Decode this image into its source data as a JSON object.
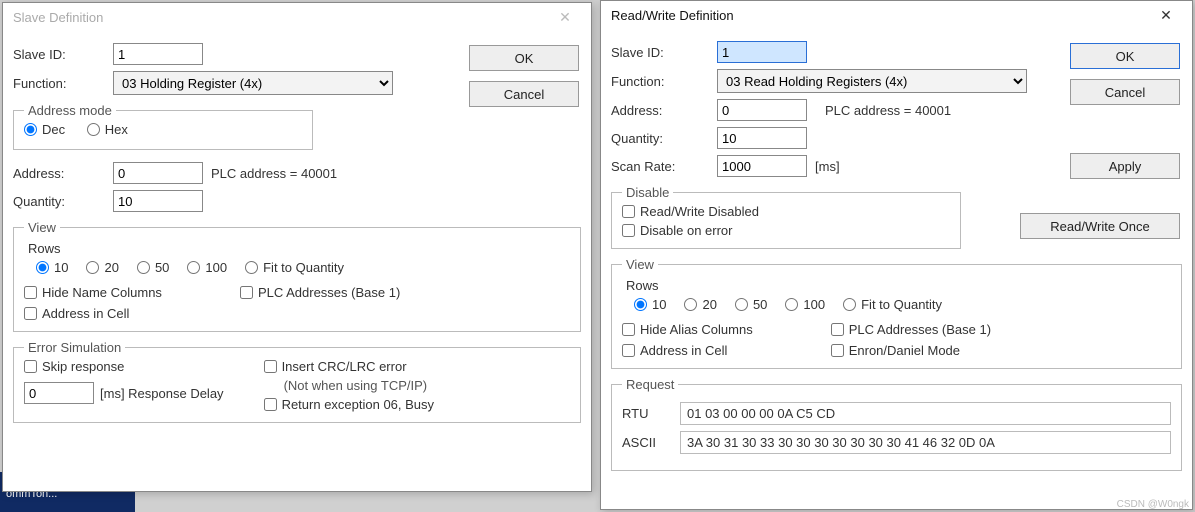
{
  "left": {
    "title": "Slave Definition",
    "ok": "OK",
    "cancel": "Cancel",
    "slave_id_label": "Slave ID:",
    "slave_id": "1",
    "function_label": "Function:",
    "function": "03 Holding Register (4x)",
    "addr_mode": {
      "legend": "Address mode",
      "dec": "Dec",
      "hex": "Hex"
    },
    "address_label": "Address:",
    "address": "0",
    "plc_hint": "PLC address = 40001",
    "quantity_label": "Quantity:",
    "quantity": "10",
    "view": {
      "legend": "View",
      "rows_label": "Rows",
      "r10": "10",
      "r20": "20",
      "r50": "50",
      "r100": "100",
      "fit": "Fit to Quantity",
      "hide_name": "Hide Name Columns",
      "plc_base1": "PLC Addresses (Base 1)",
      "addr_in_cell": "Address in Cell"
    },
    "err": {
      "legend": "Error Simulation",
      "skip": "Skip response",
      "delay_value": "0",
      "delay_suffix": "[ms] Response Delay",
      "crc": "Insert CRC/LRC error",
      "crc_note": "(Not when using TCP/IP)",
      "ret06": "Return exception 06, Busy"
    }
  },
  "right": {
    "title": "Read/Write Definition",
    "ok": "OK",
    "cancel": "Cancel",
    "apply": "Apply",
    "rw_once": "Read/Write Once",
    "slave_id_label": "Slave ID:",
    "slave_id": "1",
    "function_label": "Function:",
    "function": "03 Read Holding Registers (4x)",
    "address_label": "Address:",
    "address": "0",
    "plc_hint": "PLC address = 40001",
    "quantity_label": "Quantity:",
    "quantity": "10",
    "scan_rate_label": "Scan Rate:",
    "scan_rate": "1000",
    "scan_rate_unit": "[ms]",
    "disable": {
      "legend": "Disable",
      "rw_disabled": "Read/Write Disabled",
      "on_error": "Disable on error"
    },
    "view": {
      "legend": "View",
      "rows_label": "Rows",
      "r10": "10",
      "r20": "20",
      "r50": "50",
      "r100": "100",
      "fit": "Fit to Quantity",
      "hide_alias": "Hide Alias Columns",
      "plc_base1": "PLC Addresses (Base 1)",
      "addr_in_cell": "Address in Cell",
      "enron": "Enron/Daniel Mode"
    },
    "req": {
      "legend": "Request",
      "rtu_label": "RTU",
      "rtu": "01 03 00 00 00 0A C5 CD",
      "ascii_label": "ASCII",
      "ascii": "3A 30 31 30 33 30 30 30 30 30 30 30 41 46 32 0D 0A"
    }
  },
  "watermark": "CSDN @W0ngk",
  "taskbar": "ommTon..."
}
